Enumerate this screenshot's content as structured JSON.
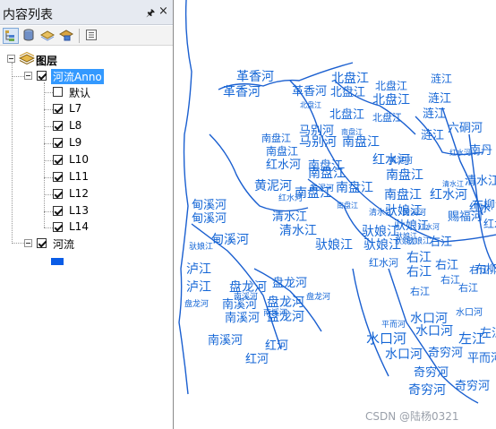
{
  "toc": {
    "title": "内容列表",
    "pin_icon": "pin-icon",
    "close_icon": "close-icon",
    "toolbar": [
      "list-by-drawing-order-icon",
      "list-by-source-icon",
      "list-by-visibility-icon",
      "list-by-selection-icon",
      "options-icon"
    ],
    "root_label": "图层",
    "anno_layer": {
      "label": "河流Anno",
      "checked": true,
      "classes": [
        {
          "label": "默认",
          "checked": false
        },
        {
          "label": "L7",
          "checked": true
        },
        {
          "label": "L8",
          "checked": true
        },
        {
          "label": "L9",
          "checked": true
        },
        {
          "label": "L10",
          "checked": true
        },
        {
          "label": "L11",
          "checked": true
        },
        {
          "label": "L12",
          "checked": true
        },
        {
          "label": "L13",
          "checked": true
        },
        {
          "label": "L14",
          "checked": true
        }
      ]
    },
    "river_layer": {
      "label": "河流",
      "checked": true,
      "symbol_color": "#0a5ce6"
    }
  },
  "map": {
    "label_color": "#1466d6",
    "line_color": "#1a5fd0",
    "labels": [
      "革香河",
      "革香河",
      "革香河",
      "北盘江",
      "北盘江",
      "北盘江",
      "北盘江",
      "北盘江",
      "北盘江",
      "北盘江",
      "涟江",
      "涟江",
      "涟江",
      "涟江",
      "六硐河",
      "南丹",
      "马别河",
      "马别河",
      "南盘江",
      "南盘江",
      "南盘江",
      "南盘江",
      "南盘江",
      "南盘江",
      "南盘江",
      "南盘江",
      "南盘江",
      "南盘江",
      "南盘江",
      "黄泥河",
      "黄泥河",
      "黄泥河",
      "红水河",
      "红水河",
      "红水河",
      "红水河",
      "红水河",
      "红水河",
      "红水河",
      "布柳河",
      "布柳河",
      "清水江",
      "清水江",
      "清水江",
      "清水江",
      "清水江",
      "甸溪河",
      "甸溪河",
      "甸溪河",
      "甸溪河",
      "驮娘江",
      "驮娘江",
      "驮娘江",
      "驮娘江",
      "驮娘江",
      "驮娘江",
      "驮娘江",
      "驮娘江",
      "驮娘江",
      "右江",
      "右江",
      "右江",
      "右江",
      "右江",
      "右江",
      "右江",
      "右江",
      "红水",
      "红水",
      "赐福河",
      "泸江",
      "泸江",
      "盘龙河",
      "盘龙河",
      "盘龙河",
      "盘龙河",
      "盘龙河",
      "盘龙河",
      "南溪河",
      "南溪河",
      "南溪河",
      "南溪河",
      "南溪河",
      "红河",
      "红河",
      "水口河",
      "水口河",
      "水口河",
      "水口河",
      "水口河",
      "左江",
      "左江",
      "奇穷河",
      "奇穷河",
      "奇穷河",
      "奇穷河",
      "平而河",
      "平而河"
    ]
  },
  "watermark": "CSDN @陆杨0321"
}
